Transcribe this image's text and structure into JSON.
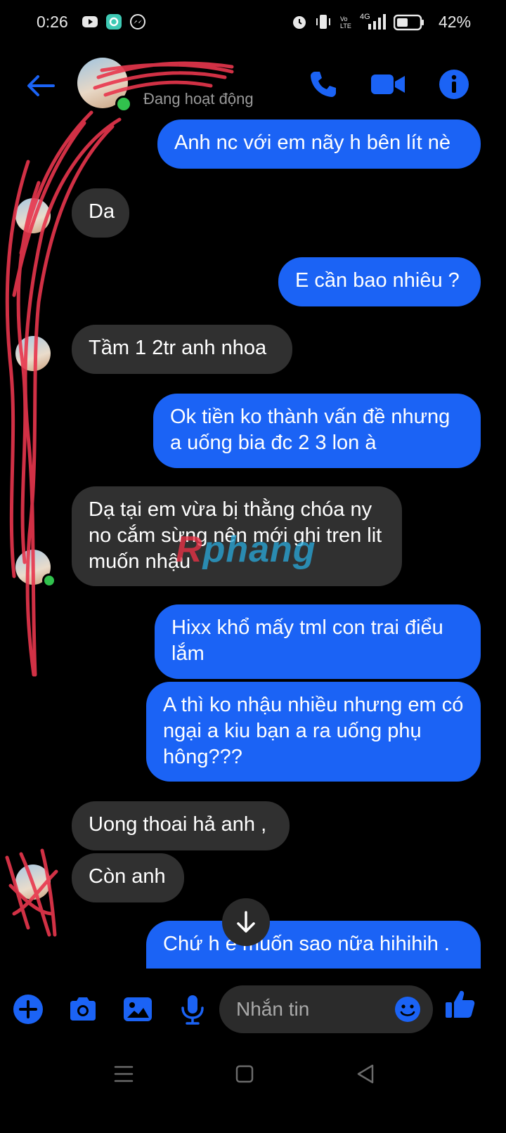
{
  "status_bar": {
    "time": "0:26",
    "battery_percent": "42%",
    "network_label": "4G",
    "left_icons": [
      "youtube-icon",
      "app-icon",
      "messenger-icon"
    ],
    "right_icons": [
      "alarm-icon",
      "vibrate-icon",
      "volte-icon",
      "signal-icon",
      "battery-icon"
    ]
  },
  "header": {
    "contact_name": "",
    "contact_status": "Đang hoạt động",
    "icons": [
      "back-arrow-icon",
      "phone-icon",
      "video-icon",
      "info-icon"
    ]
  },
  "messages": [
    {
      "dir": "out",
      "text": "Anh nc với em nãy h bên lít nè"
    },
    {
      "dir": "in",
      "text": "Da"
    },
    {
      "dir": "out",
      "text": "E cần bao nhiêu ?"
    },
    {
      "dir": "in",
      "text": "Tầm 1 2tr anh nhoa"
    },
    {
      "dir": "out",
      "text": "Ok tiền ko thành vấn đề nhưng a uống bia đc 2 3 lon à"
    },
    {
      "dir": "in",
      "text": "Dạ tại em vừa bị thằng chóa ny no cắm sừng nên mới ghi tren lit muốn nhậu"
    },
    {
      "dir": "out",
      "text": "Hixx khổ mấy tml con trai điểu lắm"
    },
    {
      "dir": "out",
      "text": "A thì ko nhậu nhiều nhưng em có ngại a kiu bạn a ra uống phụ hông???"
    },
    {
      "dir": "in",
      "text": "Uong thoai hả anh ,"
    },
    {
      "dir": "in",
      "text": "Còn anh"
    },
    {
      "dir": "out",
      "text": "Chứ h e muốn sao nữa hihihih ."
    }
  ],
  "composer": {
    "placeholder": "Nhắn tin",
    "icons": [
      "plus-icon",
      "camera-icon",
      "gallery-icon",
      "microphone-icon",
      "emoji-icon",
      "thumbs-up-icon"
    ]
  },
  "watermark": {
    "prefix": "R",
    "text": "phang"
  },
  "colors": {
    "accent": "#1b63f5",
    "incoming_bubble": "#303030",
    "online": "#31c24d",
    "background": "#000000"
  }
}
